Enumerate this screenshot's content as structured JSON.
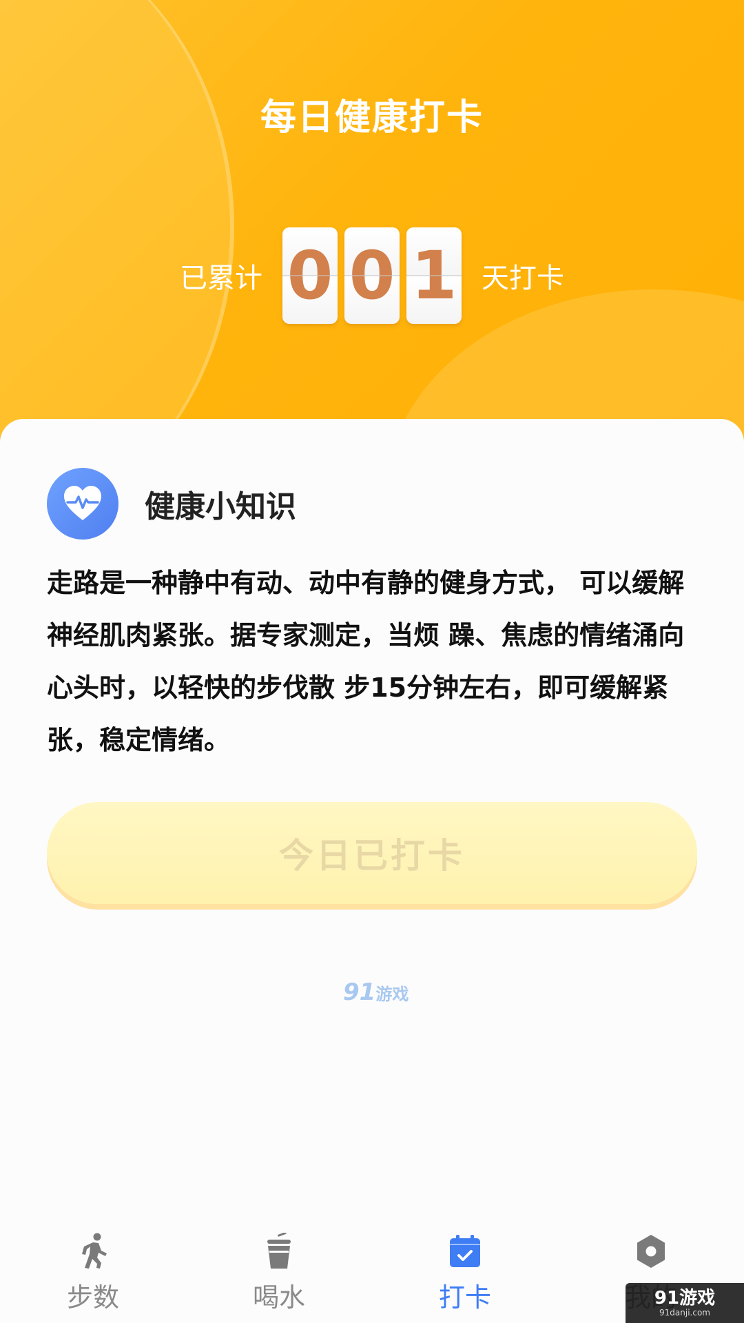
{
  "header": {
    "title": "每日健康打卡",
    "counter_prefix": "已累计",
    "digits": [
      "0",
      "0",
      "1"
    ],
    "counter_suffix": "天打卡"
  },
  "tips": {
    "icon": "heart-pulse-icon",
    "title": "健康小知识",
    "body": "走路是一种静中有动、动中有静的健身方式， 可以缓解神经肌肉紧张。据专家测定，当烦 躁、焦虑的情绪涌向心头时，以轻快的步伐散 步15分钟左右，即可缓解紧张，稳定情绪。"
  },
  "checkin_button": {
    "label": "今日已打卡"
  },
  "watermark_center": {
    "num": "91",
    "text": "游戏"
  },
  "nav": {
    "items": [
      {
        "label": "步数",
        "icon": "walking-icon",
        "active": false
      },
      {
        "label": "喝水",
        "icon": "cup-icon",
        "active": false
      },
      {
        "label": "打卡",
        "icon": "calendar-check-icon",
        "active": true
      },
      {
        "label": "我的",
        "icon": "settings-icon",
        "active": false
      }
    ]
  },
  "watermark_corner": {
    "brand": "91游戏",
    "url": "91danji.com"
  },
  "colors": {
    "header_orange": "#ffb40d",
    "digit_color": "#d2814d",
    "active_blue": "#3e7df3",
    "inactive_gray": "#8a8a8a"
  }
}
